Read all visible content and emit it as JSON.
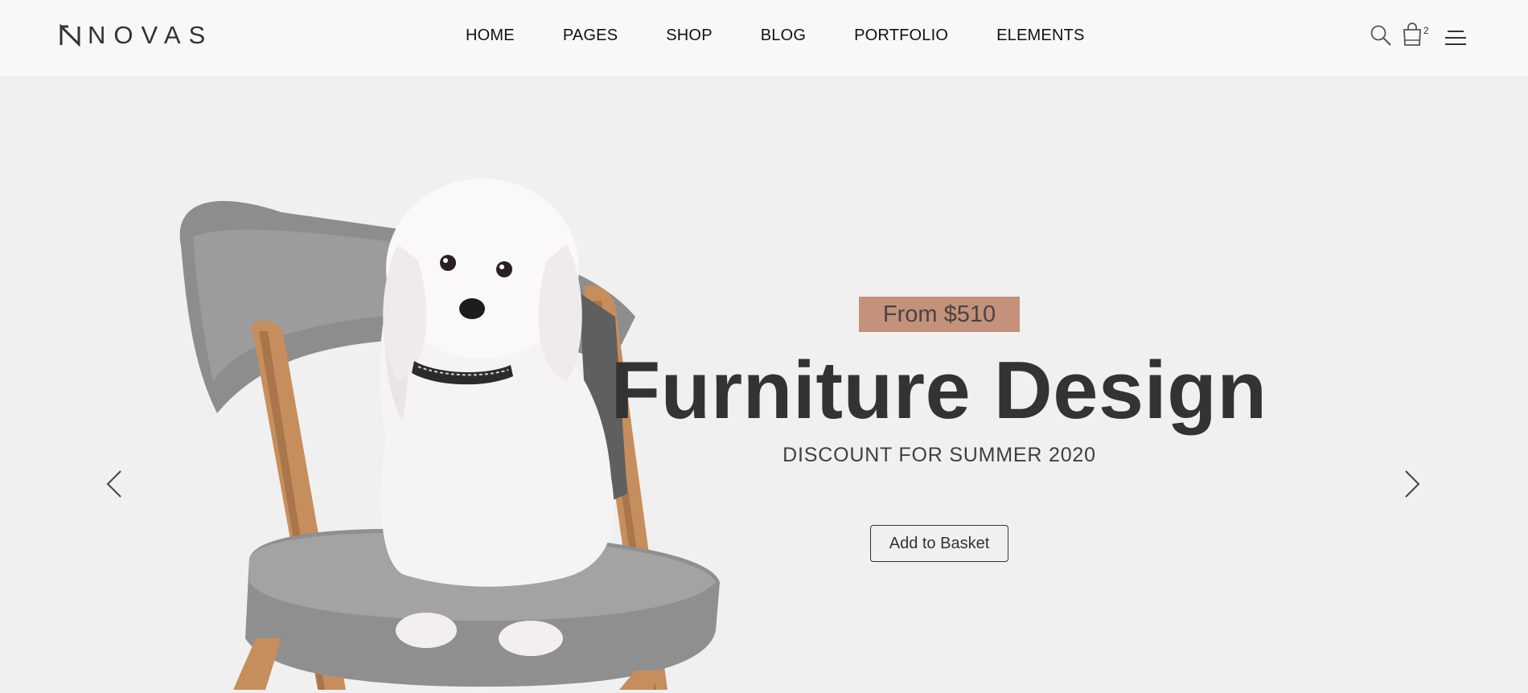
{
  "header": {
    "logo_text": "NOVAS",
    "nav": [
      {
        "label": "HOME"
      },
      {
        "label": "PAGES"
      },
      {
        "label": "SHOP"
      },
      {
        "label": "BLOG"
      },
      {
        "label": "PORTFOLIO"
      },
      {
        "label": "ELEMENTS"
      }
    ],
    "icons": {
      "search": "search-icon",
      "cart": "shopping-bag-icon",
      "menu": "hamburger-menu-icon"
    },
    "cart_count": "2"
  },
  "hero": {
    "price_tag": "From $510",
    "title": "Furniture Design",
    "subtitle": "DISCOUNT FOR SUMMER 2020",
    "cta_label": "Add to Basket",
    "image": "white-dog-on-grey-chair",
    "prev_icon": "chevron-left-icon",
    "next_icon": "chevron-right-icon"
  },
  "colors": {
    "page_bg": "#f1f0f0",
    "header_bg": "#f7f8fa",
    "accent": "#c4917a",
    "text": "#333333"
  }
}
